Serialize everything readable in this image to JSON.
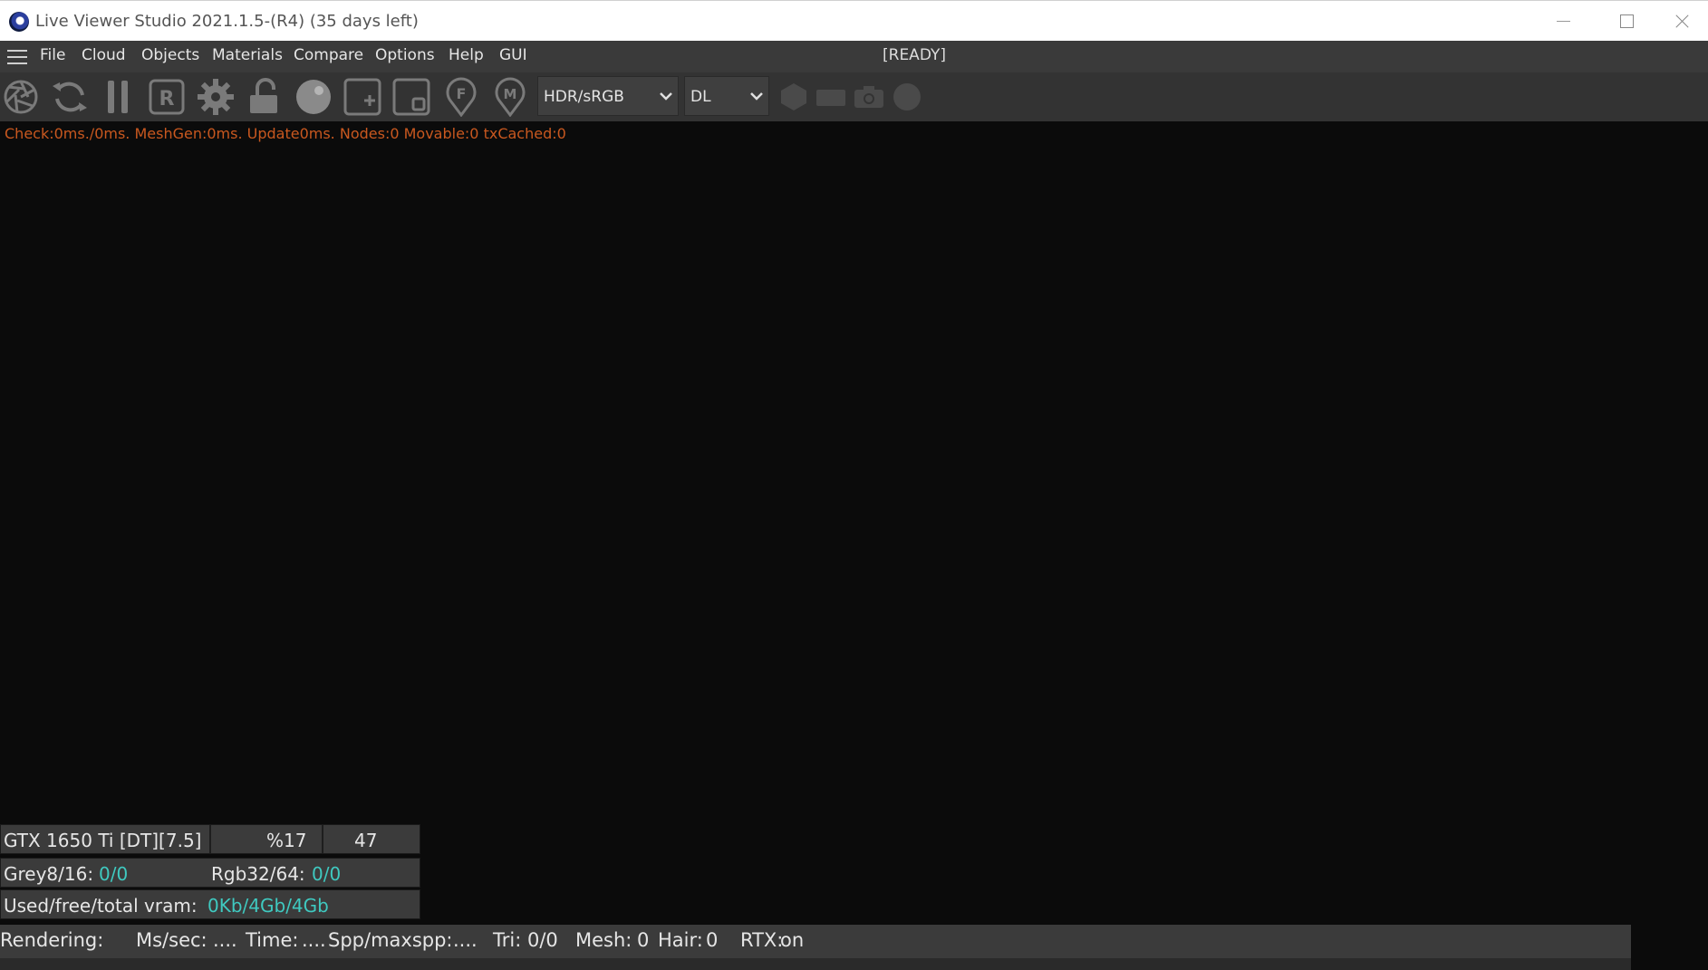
{
  "window": {
    "title": "Live Viewer Studio 2021.1.5-(R4) (35 days left)"
  },
  "menu": {
    "items": [
      "File",
      "Cloud",
      "Objects",
      "Materials",
      "Compare",
      "Options",
      "Help",
      "GUI"
    ],
    "status": "[READY]"
  },
  "toolbar": {
    "icons": [
      "aperture-icon",
      "refresh-icon",
      "pause-icon",
      "r-box-icon",
      "gear-icon",
      "unlock-icon",
      "sphere-icon",
      "add-box-icon",
      "stop-box-icon",
      "f-pin-icon",
      "m-pin-icon",
      "hexagon-icon",
      "rectangle-icon",
      "camera-icon",
      "circle-icon"
    ],
    "tonemap_select": "HDR/sRGB",
    "kernel_select": "DL"
  },
  "stats_line": "Check:0ms./0ms. MeshGen:0ms. Update0ms. Nodes:0 Movable:0 txCached:0",
  "gpu_panel": {
    "gpu_name": "GTX 1650 Ti [DT][7.5]",
    "usage": "%17",
    "temp": "47",
    "grey_label": "Grey8/16:",
    "grey_value": "0/0",
    "rgb_label": "Rgb32/64:",
    "rgb_value": "0/0",
    "vram_label": "Used/free/total vram:",
    "vram_value": "0Kb/4Gb/4Gb"
  },
  "render_bar": {
    "rendering_label": "Rendering:",
    "ms_label": "Ms/sec:",
    "ms_value": "....",
    "time_label": "Time:",
    "time_value": "....",
    "spp_label": "Spp/maxspp:",
    "spp_value": "....",
    "tri_label": "Tri:",
    "tri_value": "0/0",
    "mesh_label": "Mesh:",
    "mesh_value": "0",
    "hair_label": "Hair:",
    "hair_value": "0",
    "rtx_label": "RTX:",
    "rtx_value": "on"
  },
  "colors": {
    "accent": "#3fc9c0",
    "stats": "#c9581f",
    "viewport": "#0b0b0b"
  }
}
